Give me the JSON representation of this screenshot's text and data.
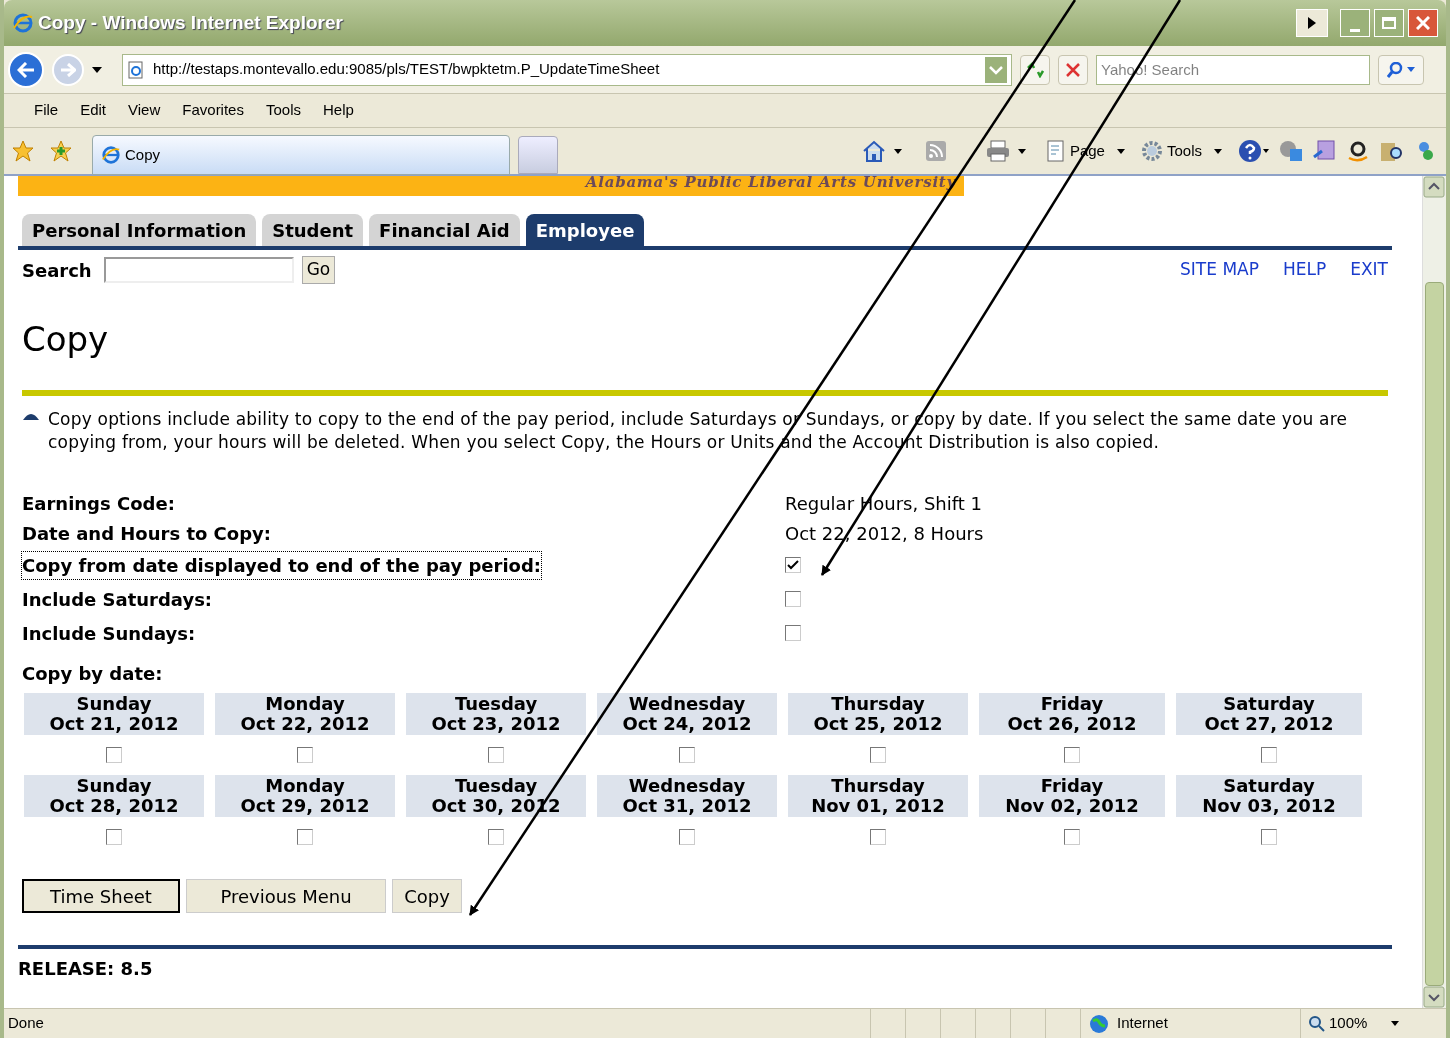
{
  "window": {
    "title": "Copy - Windows Internet Explorer"
  },
  "address_bar": {
    "url": "http://testaps.montevallo.edu:9085/pls/TEST/bwpktetm.P_UpdateTimeSheet"
  },
  "search_box": {
    "placeholder": "Yahoo! Search"
  },
  "menu": [
    "File",
    "Edit",
    "View",
    "Favorites",
    "Tools",
    "Help"
  ],
  "browser_tab": {
    "label": "Copy"
  },
  "command_bar": [
    "Page",
    "Tools"
  ],
  "page": {
    "banner": "Alabama's Public Liberal Arts University",
    "tabs": [
      {
        "label": "Personal Information",
        "selected": false
      },
      {
        "label": "Student",
        "selected": false
      },
      {
        "label": "Financial Aid",
        "selected": false
      },
      {
        "label": "Employee",
        "selected": true
      }
    ],
    "search": {
      "label": "Search",
      "button": "Go"
    },
    "links": [
      "SITE MAP",
      "HELP",
      "EXIT"
    ],
    "heading": "Copy",
    "info": "Copy options include ability to copy to the end of the pay period, include Saturdays or Sundays, or copy by date. If you select the same date you are copying from, your hours will be deleted. When you select Copy, the Hours or Units and the Account Distribution is also copied.",
    "fields": [
      {
        "kind": "text",
        "label": "Earnings Code:",
        "value": "Regular Hours, Shift 1"
      },
      {
        "kind": "text",
        "label": "Date and Hours to Copy:",
        "value": "Oct 22, 2012, 8 Hours"
      },
      {
        "kind": "checkbox",
        "label": "Copy from date displayed to end of the pay period:",
        "checked": true,
        "focused": true
      },
      {
        "kind": "checkbox",
        "label": "Include Saturdays:",
        "checked": false,
        "focused": false
      },
      {
        "kind": "checkbox",
        "label": "Include Sundays:",
        "checked": false,
        "focused": false
      }
    ],
    "copy_by_date": {
      "label": "Copy by date:",
      "weeks": [
        [
          {
            "day": "Sunday",
            "date": "Oct 21, 2012",
            "checked": false
          },
          {
            "day": "Monday",
            "date": "Oct 22, 2012",
            "checked": false
          },
          {
            "day": "Tuesday",
            "date": "Oct 23, 2012",
            "checked": false
          },
          {
            "day": "Wednesday",
            "date": "Oct 24, 2012",
            "checked": false
          },
          {
            "day": "Thursday",
            "date": "Oct 25, 2012",
            "checked": false
          },
          {
            "day": "Friday",
            "date": "Oct 26, 2012",
            "checked": false
          },
          {
            "day": "Saturday",
            "date": "Oct 27, 2012",
            "checked": false
          }
        ],
        [
          {
            "day": "Sunday",
            "date": "Oct 28, 2012",
            "checked": false
          },
          {
            "day": "Monday",
            "date": "Oct 29, 2012",
            "checked": false
          },
          {
            "day": "Tuesday",
            "date": "Oct 30, 2012",
            "checked": false
          },
          {
            "day": "Wednesday",
            "date": "Oct 31, 2012",
            "checked": false
          },
          {
            "day": "Thursday",
            "date": "Nov 01, 2012",
            "checked": false
          },
          {
            "day": "Friday",
            "date": "Nov 02, 2012",
            "checked": false
          },
          {
            "day": "Saturday",
            "date": "Nov 03, 2012",
            "checked": false
          }
        ]
      ]
    },
    "buttons": [
      {
        "label": "Time Sheet",
        "focused": true
      },
      {
        "label": "Previous Menu",
        "focused": false
      },
      {
        "label": "Copy",
        "focused": false
      }
    ],
    "release": "RELEASE: 8.5"
  },
  "status_bar": {
    "status": "Done",
    "zone": "Internet",
    "zoom": "100%"
  }
}
